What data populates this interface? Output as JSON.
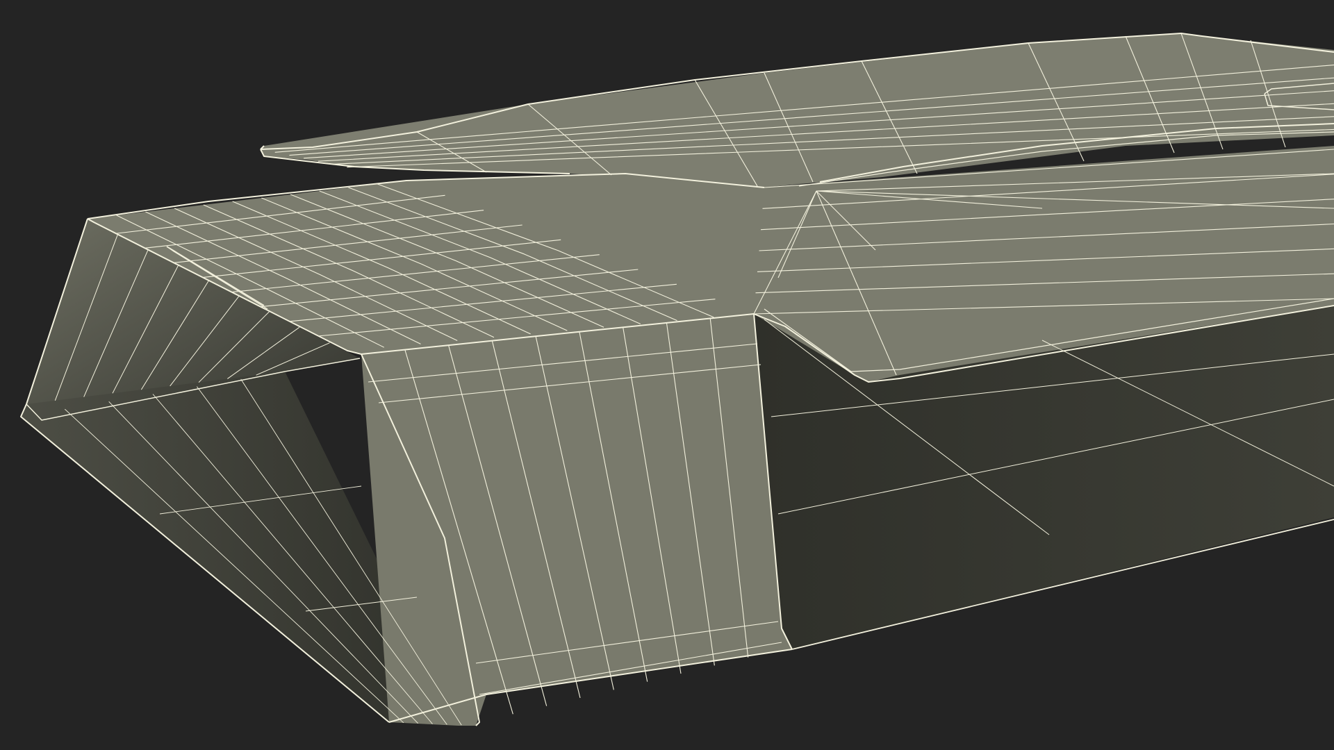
{
  "render": {
    "background_color": "#242424",
    "surface_color": "#7b7c6e",
    "surface_shadow_color": "#2c2c27",
    "wire_color": "#f3f1dd"
  }
}
